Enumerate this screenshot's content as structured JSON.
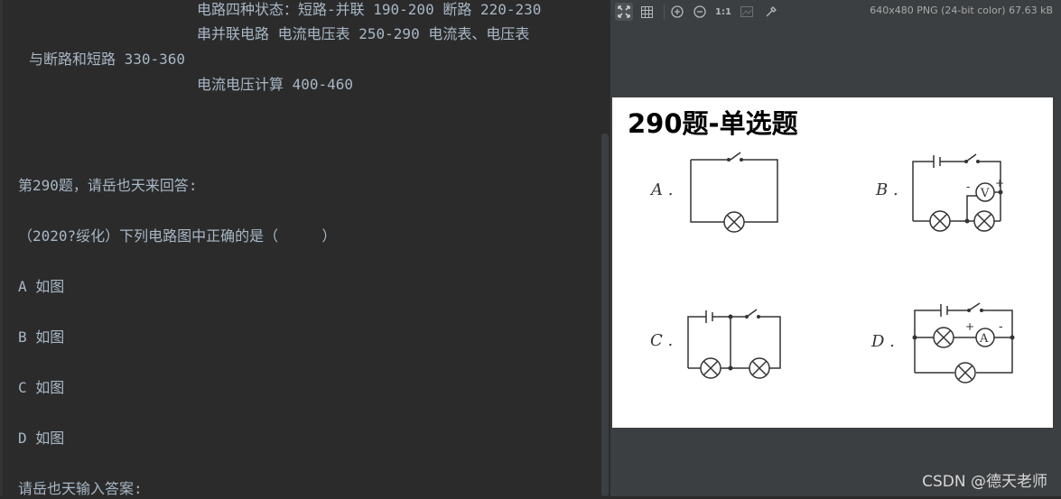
{
  "console": {
    "lines": [
      "电路四种状态：短路-并联 190-200 断路 220-230",
      "串并联电路 电流电压表 250-290 电流表、电压表",
      "与断路和短路 330-360",
      "电流电压计算 400-460",
      "第290题，请岳也天来回答:",
      "（2020?绥化）下列电路图中正确的是（     ）",
      "A 如图",
      "B 如图",
      "C 如图",
      "D 如图",
      "请岳也天输入答案:"
    ]
  },
  "viewer": {
    "toolbar": {
      "fit_icon": "fit-window-icon",
      "grid_icon": "grid-icon",
      "zoom_in_icon": "zoom-in-icon",
      "zoom_out_icon": "zoom-out-icon",
      "actual_size_label": "1:1",
      "background_icon": "background-icon",
      "color_picker_icon": "eyedropper-icon"
    },
    "image_info": "640x480 PNG (24-bit color) 67.63 kB",
    "image": {
      "title": "290题-单选题",
      "options": [
        {
          "label": "A .",
          "meter": ""
        },
        {
          "label": "B .",
          "meter": "V"
        },
        {
          "label": "C .",
          "meter": ""
        },
        {
          "label": "D .",
          "meter": "A"
        }
      ],
      "polarity_plus": "+",
      "polarity_minus": "-"
    },
    "watermark": "CSDN @德天老师"
  },
  "colors": {
    "console_bg": "#2b2b2b",
    "console_text": "#a9b7c6",
    "viewer_bg": "#3c3f41",
    "image_bg": "#ffffff"
  }
}
